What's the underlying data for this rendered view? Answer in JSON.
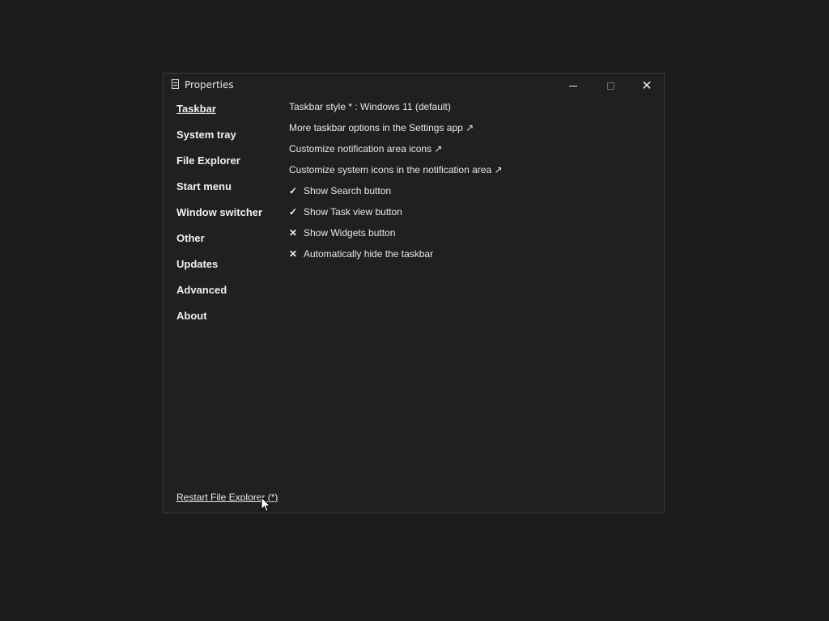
{
  "window": {
    "title": "Properties",
    "icon": "document-icon",
    "controls": {
      "minimize": "minimize-icon",
      "maximize": "maximize-icon",
      "close": "close-icon",
      "close_glyph": "✕"
    }
  },
  "sidebar": {
    "items": [
      {
        "label": "Taskbar",
        "active": true
      },
      {
        "label": "System tray"
      },
      {
        "label": "File Explorer"
      },
      {
        "label": "Start menu"
      },
      {
        "label": "Window switcher"
      },
      {
        "label": "Other"
      },
      {
        "label": "Updates"
      },
      {
        "label": "Advanced"
      },
      {
        "label": "About"
      }
    ]
  },
  "main": {
    "options": [
      {
        "label": "Taskbar style * : Windows 11 (default)",
        "mark": ""
      },
      {
        "label": "More taskbar options in the Settings app ↗",
        "mark": ""
      },
      {
        "label": "Customize notification area icons ↗",
        "mark": ""
      },
      {
        "label": "Customize system icons in the notification area ↗",
        "mark": ""
      },
      {
        "label": "Show Search button",
        "mark": "✓"
      },
      {
        "label": "Show Task view button",
        "mark": "✓"
      },
      {
        "label": "Show Widgets button",
        "mark": "✕"
      },
      {
        "label": "Automatically hide the taskbar",
        "mark": "✕"
      }
    ]
  },
  "footer": {
    "restart_label": "Restart File Explorer (*)"
  },
  "colors": {
    "desktop": "#1c1c1c",
    "window_bg": "#202020",
    "text": "#e8e8e8"
  }
}
